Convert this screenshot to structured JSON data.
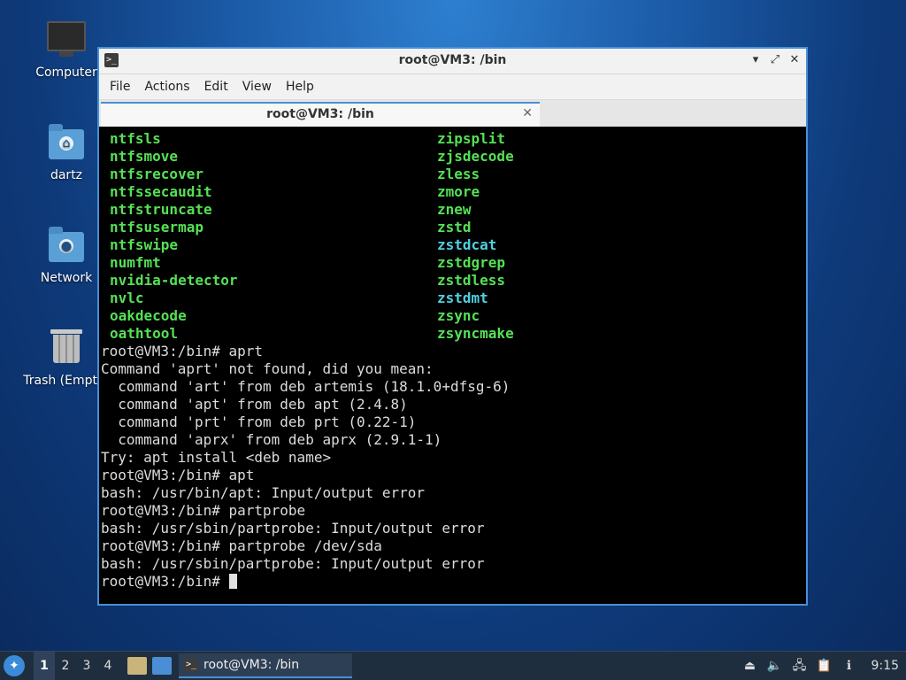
{
  "desktop": {
    "icons": [
      {
        "label": "Computer",
        "icon": "computer-icon"
      },
      {
        "label": "dartz",
        "icon": "home-folder-icon"
      },
      {
        "label": "Network",
        "icon": "network-folder-icon"
      },
      {
        "label": "Trash (Empty)",
        "icon": "trash-icon"
      }
    ]
  },
  "window": {
    "title": "root@VM3: /bin",
    "menu": [
      "File",
      "Actions",
      "Edit",
      "View",
      "Help"
    ],
    "tab": {
      "label": "root@VM3: /bin"
    }
  },
  "terminal": {
    "colors": {
      "exec": "#55e055",
      "link": "#4fd0e0",
      "text": "#dcdcdc"
    },
    "ls_rows": [
      {
        "left": "ntfsls",
        "right": "zipsplit",
        "right_link": false
      },
      {
        "left": "ntfsmove",
        "right": "zjsdecode",
        "right_link": false
      },
      {
        "left": "ntfsrecover",
        "right": "zless",
        "right_link": false
      },
      {
        "left": "ntfssecaudit",
        "right": "zmore",
        "right_link": false
      },
      {
        "left": "ntfstruncate",
        "right": "znew",
        "right_link": false
      },
      {
        "left": "ntfsusermap",
        "right": "zstd",
        "right_link": false
      },
      {
        "left": "ntfswipe",
        "right": "zstdcat",
        "right_link": true
      },
      {
        "left": "numfmt",
        "right": "zstdgrep",
        "right_link": false
      },
      {
        "left": "nvidia-detector",
        "right": "zstdless",
        "right_link": false
      },
      {
        "left": "nvlc",
        "right": "zstdmt",
        "right_link": true
      },
      {
        "left": "oakdecode",
        "right": "zsync",
        "right_link": false
      },
      {
        "left": "oathtool",
        "right": "zsyncmake",
        "right_link": false
      }
    ],
    "lines": [
      "root@VM3:/bin# aprt",
      "Command 'aprt' not found, did you mean:",
      "  command 'art' from deb artemis (18.1.0+dfsg-6)",
      "  command 'apt' from deb apt (2.4.8)",
      "  command 'prt' from deb prt (0.22-1)",
      "  command 'aprx' from deb aprx (2.9.1-1)",
      "Try: apt install <deb name>",
      "root@VM3:/bin# apt",
      "bash: /usr/bin/apt: Input/output error",
      "root@VM3:/bin# partprobe",
      "bash: /usr/sbin/partprobe: Input/output error",
      "root@VM3:/bin# partprobe /dev/sda",
      "bash: /usr/sbin/partprobe: Input/output error"
    ],
    "prompt": "root@VM3:/bin# "
  },
  "taskbar": {
    "workspaces": [
      "1",
      "2",
      "3",
      "4"
    ],
    "active_workspace": "1",
    "task_label": "root@VM3: /bin",
    "clock": "9:15"
  }
}
